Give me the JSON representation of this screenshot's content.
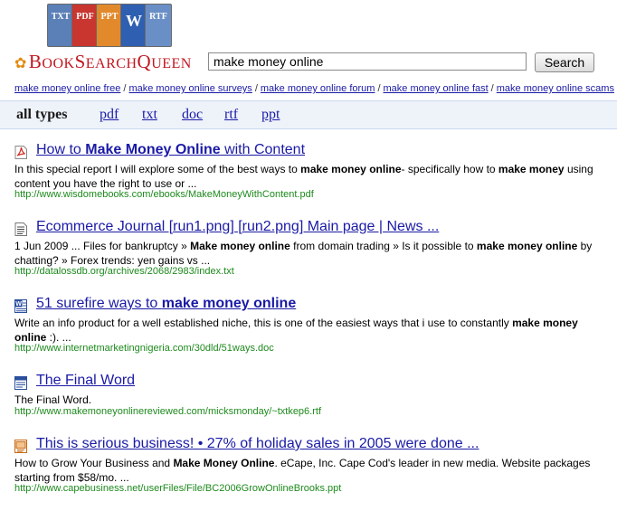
{
  "brand": {
    "name_part1": "B",
    "name_part1_small": "OOK",
    "name_part2": "S",
    "name_part2_small": "EARCH",
    "name_part3": "Q",
    "name_part3_small": "UEEN",
    "books": [
      "TXT",
      "PDF",
      "PPT",
      "W",
      "RTF"
    ]
  },
  "search": {
    "query": "make money online",
    "button_label": "Search"
  },
  "related": [
    "make money online free",
    "make money online surveys",
    "make money online forum",
    "make money online fast",
    "make money online scams"
  ],
  "related_sep": "/",
  "types": {
    "all_label": "all types",
    "items": [
      "pdf",
      "txt",
      "doc",
      "rtf",
      "ppt"
    ]
  },
  "results": [
    {
      "icon": "pdf-file-icon",
      "title_parts": [
        "How to ",
        "Make Money Online",
        " with Content"
      ],
      "snippet_parts": [
        "In this special report I will explore some of the best ways to ",
        "make money online",
        "- specifically how to ",
        "make money",
        " using content you have the right to use or ..."
      ],
      "url": "http://www.wisdomebooks.com/ebooks/MakeMoneyWithContent.pdf"
    },
    {
      "icon": "txt-file-icon",
      "title_parts": [
        "Ecommerce Journal [run1.png] [run2.png] Main page | News ..."
      ],
      "snippet_parts": [
        "1 Jun 2009 ... Files for bankruptcy » ",
        "Make money online",
        " from domain trading » Is it possible to ",
        "make money online",
        " by chatting? » Forex trends: yen gains vs ..."
      ],
      "url": "http://datalossdb.org/archives/2068/2983/index.txt"
    },
    {
      "icon": "doc-file-icon",
      "title_parts": [
        "51 surefire ways to ",
        "make money online"
      ],
      "snippet_parts": [
        "Write an info product for a well established niche, this is one of the easiest ways that i use to constantly ",
        "make money online",
        " :). ..."
      ],
      "url": "http://www.internetmarketingnigeria.com/30dld/51ways.doc"
    },
    {
      "icon": "rtf-file-icon",
      "title_parts": [
        "The Final Word"
      ],
      "snippet_parts": [
        "The Final Word."
      ],
      "url": "http://www.makemoneyonlinereviewed.com/micksmonday/~txtkep6.rtf"
    },
    {
      "icon": "ppt-file-icon",
      "title_parts": [
        "This is serious business! • 27% of holiday sales in 2005 were done ..."
      ],
      "snippet_parts": [
        "How to Grow Your Business and ",
        "Make Money Online",
        ". eCape, Inc. Cape Cod's leader in new media. Website packages starting from $58/mo. ..."
      ],
      "url": "http://www.capebusiness.net/userFiles/File/BC2006GrowOnlineBrooks.ppt"
    }
  ],
  "colors": {
    "link": "#1a1aa6",
    "url": "#1d8a1d",
    "brand": "#c0171f",
    "bar_bg": "#eef3fa"
  }
}
